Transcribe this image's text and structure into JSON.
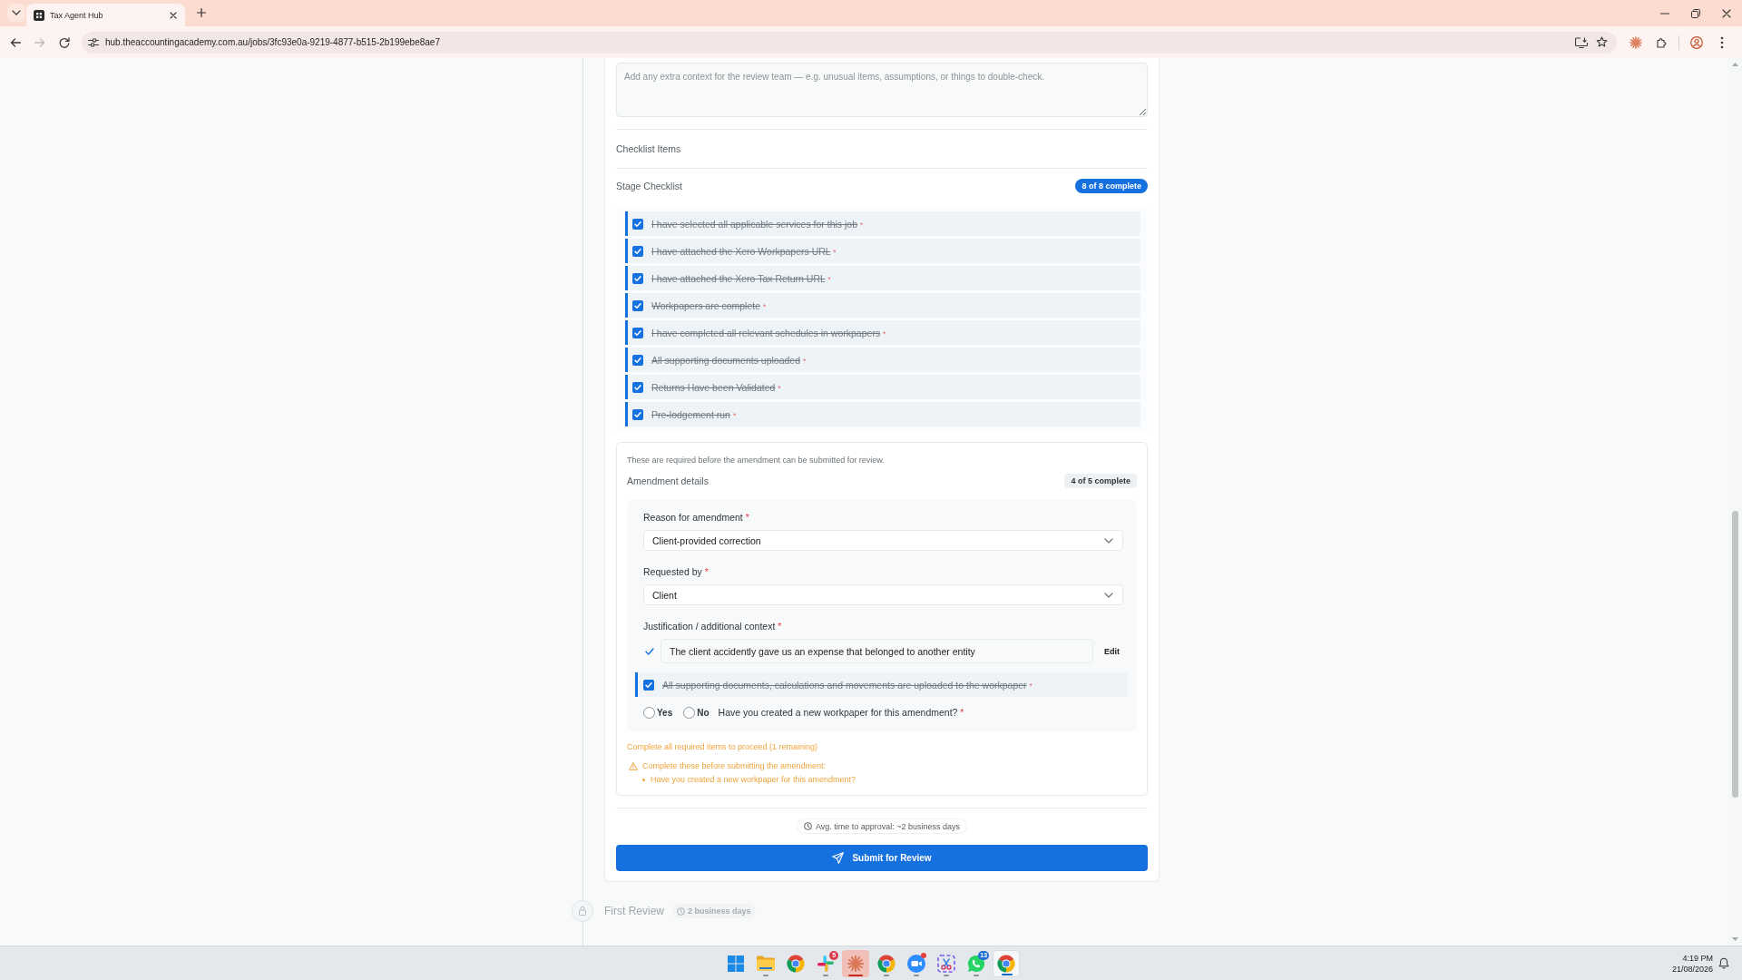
{
  "browser": {
    "tabs": [
      {
        "title": "Tax Agent Hub",
        "selected": true
      }
    ],
    "nav_buttons": [
      {
        "kind": "back",
        "disabled": false
      },
      {
        "kind": "forward",
        "disabled": true
      },
      {
        "kind": "reload",
        "disabled": false
      }
    ],
    "url": "hub.theaccountingacademy.com.au/jobs/3fc93e0a-9219-4877-b515-2b199ebe8ae7"
  },
  "stage": {
    "notes": {
      "placeholder": "Add any extra context for the review team — e.g. unusual items, assumptions, or things to double-check."
    },
    "checklist_heading": "Checklist Items",
    "stage_checklist": {
      "title": "Stage Checklist",
      "badge": "8 of 8 complete",
      "complete": true,
      "items": [
        {
          "label": "I have selected all applicable services for this job",
          "required_mark": "*",
          "checked": true
        },
        {
          "label": "I have attached the Xero Workpapers URL",
          "required_mark": "*",
          "checked": true
        },
        {
          "label": "I have attached the Xero Tax Return URL",
          "required_mark": "*",
          "checked": true
        },
        {
          "label": "Workpapers are complete",
          "required_mark": "*",
          "checked": true
        },
        {
          "label": "I have completed all relevant schedules in workpapers",
          "required_mark": "*",
          "checked": true
        },
        {
          "label": "All supporting documents uploaded",
          "required_mark": "*",
          "checked": true
        },
        {
          "label": "Returns Have been Validated",
          "required_mark": "*",
          "checked": true
        },
        {
          "label": "Pre-lodgement run",
          "required_mark": "*",
          "checked": true
        }
      ]
    },
    "amendment": {
      "note": "These are required before the amendment can be submitted for review.",
      "title": "Amendment details",
      "badge": "4 of 5 complete",
      "complete": false,
      "fields": [
        {
          "kind": "select",
          "label": "Reason for amendment",
          "required_mark": "*",
          "value": "Client-provided correction"
        },
        {
          "kind": "select",
          "label": "Requested by",
          "required_mark": "*",
          "value": "Client"
        },
        {
          "kind": "text",
          "label": "Justification / additional context",
          "required_mark": "*",
          "value": "The client accidently gave us an expense that belonged to another entity",
          "confirmed": true,
          "action": "Edit"
        },
        {
          "kind": "checkbox",
          "label": "All supporting documents, calculations and movements are uploaded to the workpaper",
          "required_mark": "*",
          "checked": true
        },
        {
          "kind": "yesno",
          "label": "Have you created a new workpaper for this amendment?",
          "required_mark": "*",
          "options": [
            {
              "label": "Yes",
              "selected": false
            },
            {
              "label": "No",
              "selected": false
            }
          ]
        }
      ],
      "progress": "Complete all required items to proceed (1 remaining)",
      "warning": {
        "title": "Complete these before submitting the amendment:",
        "items": [
          "Have you created a new workpaper for this amendment?"
        ]
      }
    },
    "approval_time": "Avg. time to approval: ~2 business days",
    "submit_label": "Submit for Review"
  },
  "next_stages": [
    {
      "title": "First Review",
      "duration": "2 business days",
      "locked": true
    }
  ],
  "taskbar": {
    "apps": [
      {
        "kind": "start",
        "running": false,
        "selected": false,
        "flashing": false,
        "alert": false
      },
      {
        "kind": "folder",
        "running": true,
        "selected": false,
        "flashing": false,
        "alert": false
      },
      {
        "kind": "browser",
        "running": false,
        "selected": false,
        "flashing": false,
        "alert": false
      },
      {
        "kind": "pinwheel",
        "running": true,
        "selected": false,
        "flashing": false,
        "alert": false,
        "badge": {
          "text": "5",
          "color": "#d83b4b"
        }
      },
      {
        "kind": "burst",
        "running": true,
        "selected": false,
        "flashing": true,
        "alert": false
      },
      {
        "kind": "browser",
        "running": true,
        "selected": false,
        "flashing": false,
        "alert": false
      },
      {
        "kind": "video",
        "running": true,
        "selected": false,
        "flashing": false,
        "alert": true
      },
      {
        "kind": "snip",
        "running": true,
        "selected": false,
        "flashing": false,
        "alert": false
      },
      {
        "kind": "chat",
        "running": true,
        "selected": false,
        "flashing": false,
        "alert": false,
        "badge": {
          "text": "13",
          "color": "#1f6fd6"
        }
      },
      {
        "kind": "browser",
        "running": true,
        "selected": true,
        "flashing": false,
        "alert": false
      }
    ],
    "time": "4:19 PM",
    "date": "21/08/2026"
  }
}
